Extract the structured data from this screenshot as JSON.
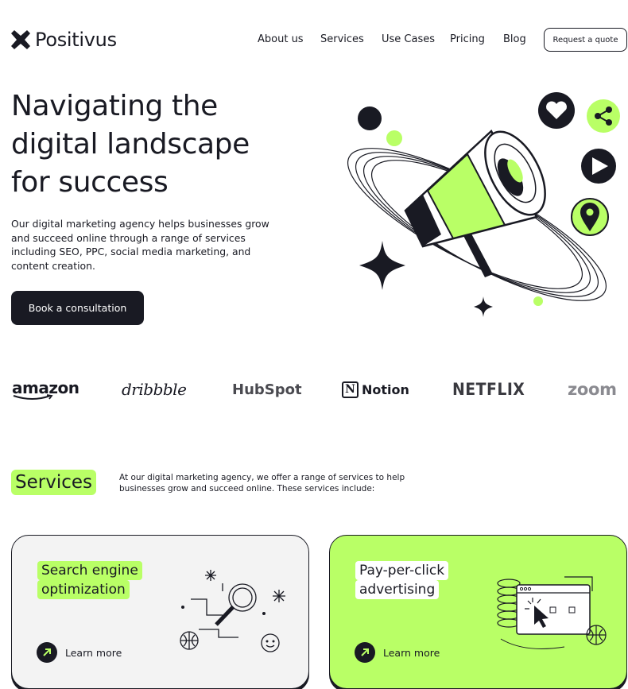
{
  "header": {
    "logo_text": "Positivus",
    "logo_icon": "asterisk-logo-icon",
    "nav": [
      "About us",
      "Services",
      "Use Cases",
      "Pricing",
      "Blog"
    ],
    "cta": "Request a quote"
  },
  "hero": {
    "title": "Navigating the digital landscape for success",
    "text": "Our digital marketing agency helps businesses grow and succeed online through a range of services including SEO, PPC, social media marketing, and content creation.",
    "button": "Book a consultation",
    "illustration_icons": [
      "megaphone-icon",
      "heart-icon",
      "share-icon",
      "play-icon",
      "location-pin-icon",
      "sparkle-icon"
    ]
  },
  "brands": {
    "amazon": "amazon",
    "dribbble": "dribbble",
    "hubspot": "HubSpot",
    "notion": "Notion",
    "notion_mark": "N",
    "netflix": "NETFLIX",
    "zoom": "zoom"
  },
  "services": {
    "heading": "Services",
    "description": "At our digital marketing agency, we offer a range of services to help businesses grow and succeed online. These services include:",
    "cards": [
      {
        "title_line1": "Search engine",
        "title_line2": "optimization",
        "link": "Learn more"
      },
      {
        "title_line1": "Pay-per-click",
        "title_line2": "advertising",
        "link": "Learn more"
      }
    ]
  },
  "colors": {
    "accent": "#B9FF66",
    "dark": "#191A23",
    "card_grey": "#F3F3F3"
  }
}
